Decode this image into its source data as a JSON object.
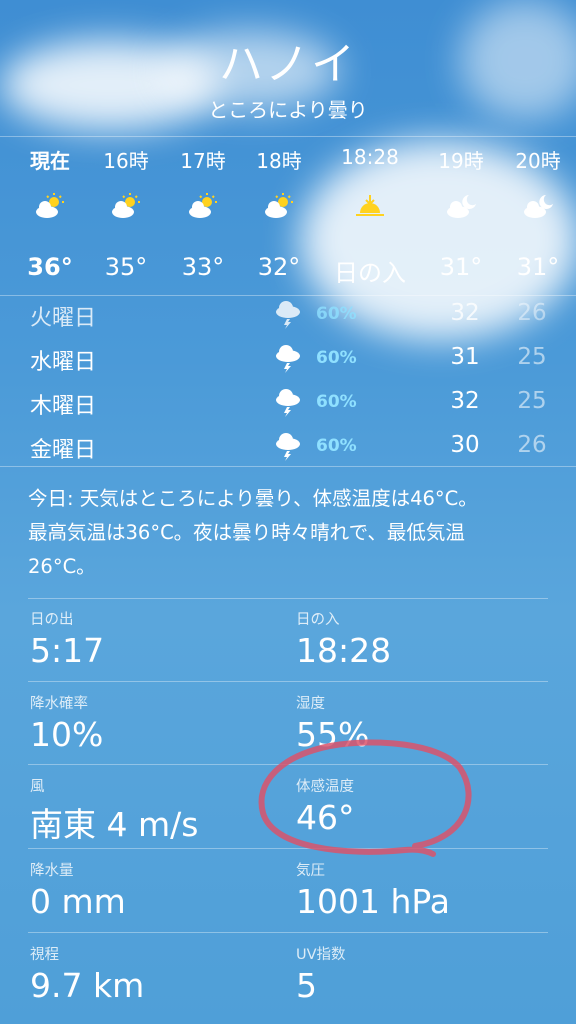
{
  "location": {
    "city": "ハノイ",
    "condition": "ところにより曇り"
  },
  "hourly": [
    {
      "time": "現在",
      "icon": "partly-cloudy-day-icon",
      "temp": "36°"
    },
    {
      "time": "16時",
      "icon": "partly-cloudy-day-icon",
      "temp": "35°"
    },
    {
      "time": "17時",
      "icon": "partly-cloudy-day-icon",
      "temp": "33°"
    },
    {
      "time": "18時",
      "icon": "partly-cloudy-day-icon",
      "temp": "32°"
    },
    {
      "time": "18:28",
      "icon": "sunset-icon",
      "temp": "日の入"
    },
    {
      "time": "19時",
      "icon": "partly-cloudy-night-icon",
      "temp": "31°"
    },
    {
      "time": "20時",
      "icon": "partly-cloudy-night-icon",
      "temp": "31°"
    }
  ],
  "daily": [
    {
      "day": "火曜日",
      "icon": "thunderstorm-icon",
      "precip": "60%",
      "high": "32",
      "low": "26"
    },
    {
      "day": "水曜日",
      "icon": "thunderstorm-icon",
      "precip": "60%",
      "high": "31",
      "low": "25"
    },
    {
      "day": "木曜日",
      "icon": "thunderstorm-icon",
      "precip": "60%",
      "high": "32",
      "low": "25"
    },
    {
      "day": "金曜日",
      "icon": "thunderstorm-icon",
      "precip": "60%",
      "high": "30",
      "low": "26"
    }
  ],
  "summary": {
    "line1": "今日: 天気はところにより曇り、体感温度は46°C。",
    "line2": "最高気温は36°C。夜は曇り時々晴れで、最低気温",
    "line3": "26°C。"
  },
  "details": [
    {
      "left_label": "日の出",
      "left_value": "5:17",
      "right_label": "日の入",
      "right_value": "18:28"
    },
    {
      "left_label": "降水確率",
      "left_value": "10%",
      "right_label": "湿度",
      "right_value": "55%"
    },
    {
      "left_label": "風",
      "left_value": "南東 4 m/s",
      "right_label": "体感温度",
      "right_value": "46°"
    },
    {
      "left_label": "降水量",
      "left_value": "0 mm",
      "right_label": "気圧",
      "right_value": "1001 hPa"
    },
    {
      "left_label": "視程",
      "left_value": "9.7 km",
      "right_label": "UV指数",
      "right_value": "5"
    }
  ],
  "annotation_color": "#d9536b",
  "precip_color": "#8fe0ff"
}
